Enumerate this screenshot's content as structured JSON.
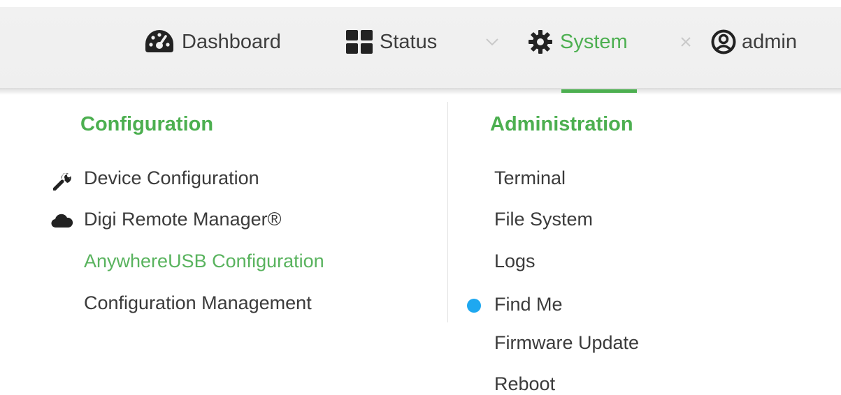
{
  "topnav": {
    "dashboard": {
      "label": "Dashboard",
      "icon": "dashboard-gauge-icon"
    },
    "status": {
      "label": "Status",
      "icon": "grid-icon"
    },
    "system": {
      "label": "System",
      "icon": "gear-icon",
      "active": true
    },
    "user": {
      "label": "admin",
      "icon": "user-circle-icon"
    }
  },
  "menu": {
    "configuration": {
      "title": "Configuration",
      "items": [
        {
          "label": "Device Configuration",
          "icon": "wrench-icon"
        },
        {
          "label": "Digi Remote Manager®",
          "icon": "cloud-icon"
        },
        {
          "label": "AnywhereUSB Configuration",
          "selected": true
        },
        {
          "label": "Configuration Management"
        }
      ]
    },
    "administration": {
      "title": "Administration",
      "items": [
        {
          "label": "Terminal"
        },
        {
          "label": "File System"
        },
        {
          "label": "Logs"
        },
        {
          "label": "Find Me",
          "icon": "status-dot-icon"
        },
        {
          "label": "Firmware Update"
        },
        {
          "label": "Reboot"
        }
      ]
    }
  },
  "colors": {
    "accent": "#4caf50",
    "text": "#3b3b3b",
    "find_me_dot": "#1ea8f0",
    "topbar_bg": "#efefef"
  }
}
